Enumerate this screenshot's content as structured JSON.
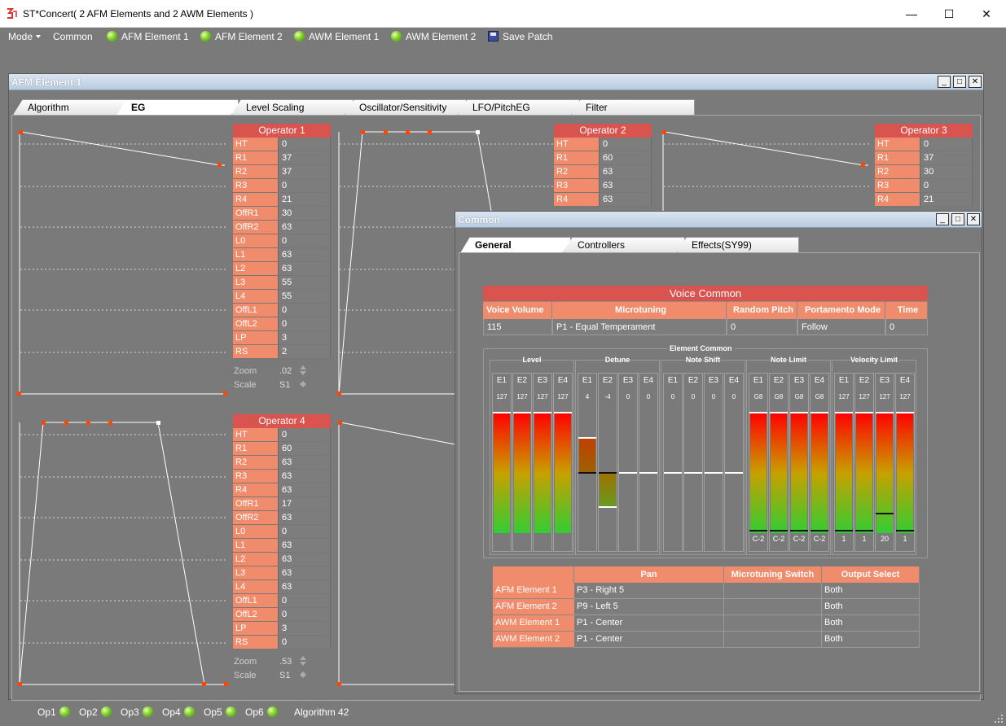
{
  "app": {
    "title": "ST*Concert( 2 AFM Elements and 2 AWM Elements )"
  },
  "menu": {
    "mode": "Mode",
    "common": "Common",
    "afm1": "AFM Element 1",
    "afm2": "AFM Element 2",
    "awm1": "AWM Element 1",
    "awm2": "AWM Element 2",
    "save": "Save Patch"
  },
  "afm_window": {
    "title": "AFM Element 1",
    "tabs": [
      "Algorithm",
      "EG",
      "Level Scaling",
      "Oscillator/Sensitivity",
      "LFO/PitchEG",
      "Filter"
    ],
    "active_tab": "EG",
    "op1": {
      "title": "Operator 1",
      "rows": [
        [
          "HT",
          "0"
        ],
        [
          "R1",
          "37"
        ],
        [
          "R2",
          "37"
        ],
        [
          "R3",
          "0"
        ],
        [
          "R4",
          "21"
        ],
        [
          "OffR1",
          "30"
        ],
        [
          "OffR2",
          "63"
        ],
        [
          "L0",
          "0"
        ],
        [
          "L1",
          "63"
        ],
        [
          "L2",
          "63"
        ],
        [
          "L3",
          "55"
        ],
        [
          "L4",
          "55"
        ],
        [
          "OffL1",
          "0"
        ],
        [
          "OffL2",
          "0"
        ],
        [
          "LP",
          "3"
        ],
        [
          "RS",
          "2"
        ]
      ],
      "zoom_label": "Zoom",
      "zoom": ".02",
      "scale_label": "Scale",
      "scale": "S1"
    },
    "op2": {
      "title": "Operator 2",
      "rows": [
        [
          "HT",
          "0"
        ],
        [
          "R1",
          "60"
        ],
        [
          "R2",
          "63"
        ],
        [
          "R3",
          "63"
        ],
        [
          "R4",
          "63"
        ]
      ]
    },
    "op3": {
      "title": "Operator 3",
      "rows": [
        [
          "HT",
          "0"
        ],
        [
          "R1",
          "37"
        ],
        [
          "R2",
          "30"
        ],
        [
          "R3",
          "0"
        ],
        [
          "R4",
          "21"
        ]
      ]
    },
    "op4": {
      "title": "Operator 4",
      "rows": [
        [
          "HT",
          "0"
        ],
        [
          "R1",
          "60"
        ],
        [
          "R2",
          "63"
        ],
        [
          "R3",
          "63"
        ],
        [
          "R4",
          "63"
        ],
        [
          "OffR1",
          "17"
        ],
        [
          "OffR2",
          "63"
        ],
        [
          "L0",
          "0"
        ],
        [
          "L1",
          "63"
        ],
        [
          "L2",
          "63"
        ],
        [
          "L3",
          "63"
        ],
        [
          "L4",
          "63"
        ],
        [
          "OffL1",
          "0"
        ],
        [
          "OffL2",
          "0"
        ],
        [
          "LP",
          "3"
        ],
        [
          "RS",
          "0"
        ]
      ],
      "zoom_label": "Zoom",
      "zoom": ".53",
      "scale_label": "Scale",
      "scale": "S1"
    }
  },
  "common_window": {
    "title": "Common",
    "tabs": [
      "General",
      "Controllers",
      "Effects(SY99)"
    ],
    "active_tab": "General",
    "voice_common": {
      "title": "Voice Common",
      "headers": [
        "Voice Volume",
        "Microtuning",
        "Random Pitch",
        "Portamento Mode",
        "Time"
      ],
      "values": [
        "115",
        "P1 - Equal Temperament",
        "0",
        "Follow",
        "0"
      ]
    },
    "element_common": {
      "title": "Element Common",
      "groups": [
        {
          "name": "Level",
          "channels": [
            {
              "label": "E1",
              "value": "127",
              "bottom": "",
              "level": 1.0
            },
            {
              "label": "E2",
              "value": "127",
              "bottom": "",
              "level": 1.0
            },
            {
              "label": "E3",
              "value": "127",
              "bottom": "",
              "level": 1.0
            },
            {
              "label": "E4",
              "value": "127",
              "bottom": "",
              "level": 1.0
            }
          ]
        },
        {
          "name": "Detune",
          "channels": [
            {
              "label": "E1",
              "value": "4",
              "bottom": ""
            },
            {
              "label": "E2",
              "value": "-4",
              "bottom": ""
            },
            {
              "label": "E3",
              "value": "0",
              "bottom": ""
            },
            {
              "label": "E4",
              "value": "0",
              "bottom": ""
            }
          ]
        },
        {
          "name": "Note Shift",
          "channels": [
            {
              "label": "E1",
              "value": "0",
              "bottom": ""
            },
            {
              "label": "E2",
              "value": "0",
              "bottom": ""
            },
            {
              "label": "E3",
              "value": "0",
              "bottom": ""
            },
            {
              "label": "E4",
              "value": "0",
              "bottom": ""
            }
          ]
        },
        {
          "name": "Note Limit",
          "channels": [
            {
              "label": "E1",
              "value": "G8",
              "bottom": "C-2"
            },
            {
              "label": "E2",
              "value": "G8",
              "bottom": "C-2"
            },
            {
              "label": "E3",
              "value": "G8",
              "bottom": "C-2"
            },
            {
              "label": "E4",
              "value": "G8",
              "bottom": "C-2"
            }
          ]
        },
        {
          "name": "Velocity Limit",
          "channels": [
            {
              "label": "E1",
              "value": "127",
              "bottom": "1"
            },
            {
              "label": "E2",
              "value": "127",
              "bottom": "1"
            },
            {
              "label": "E3",
              "value": "127",
              "bottom": "20"
            },
            {
              "label": "E4",
              "value": "127",
              "bottom": "1"
            }
          ]
        }
      ]
    },
    "pan_table": {
      "headers": [
        "",
        "Pan",
        "Microtuning Switch",
        "Output Select"
      ],
      "rows": [
        [
          "AFM Element 1",
          "P3 - Right 5",
          "",
          "Both"
        ],
        [
          "AFM Element 2",
          "P9 - Left 5",
          "",
          "Both"
        ],
        [
          "AWM Element 1",
          "P1 - Center",
          "",
          "Both"
        ],
        [
          "AWM Element 2",
          "P1 - Center",
          "",
          "Both"
        ]
      ]
    }
  },
  "bottom": {
    "ops": [
      "Op1",
      "Op2",
      "Op3",
      "Op4",
      "Op5",
      "Op6"
    ],
    "algorithm": "Algorithm 42"
  },
  "colors": {
    "header_red": "#d9534f",
    "salmon": "#f08c6c",
    "led_green": "#7fd02a"
  }
}
